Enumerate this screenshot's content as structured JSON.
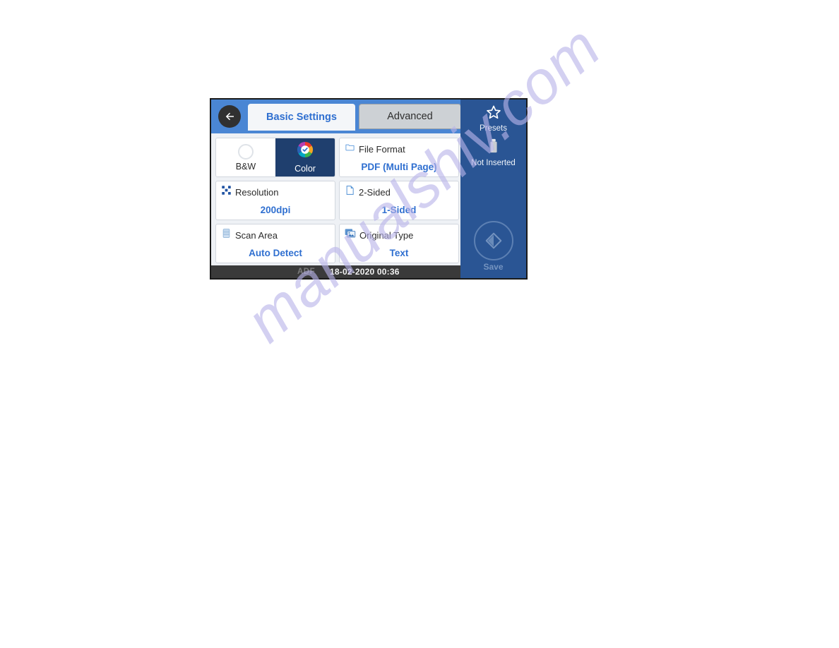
{
  "panel": {
    "header": {
      "back_icon": "back-arrow-icon",
      "tabs": [
        {
          "label": "Basic Settings",
          "active": true
        },
        {
          "label": "Advanced",
          "active": false
        }
      ]
    },
    "color_mode": {
      "bw": {
        "label": "B&W",
        "icon": "empty-circle-icon",
        "selected": false
      },
      "color": {
        "label": "Color",
        "icon": "color-wheel-check-icon",
        "selected": true
      }
    },
    "settings": [
      {
        "label": "File Format",
        "value": "PDF (Multi Page)",
        "icon": "folder-icon"
      },
      {
        "label": "Resolution",
        "value": "200dpi",
        "icon": "dot-matrix-icon"
      },
      {
        "label": "2-Sided",
        "value": "1-Sided",
        "icon": "page-corner-icon"
      },
      {
        "label": "Scan Area",
        "value": "Auto Detect",
        "icon": "document-stack-icon"
      },
      {
        "label": "Original Type",
        "value": "Text",
        "icon": "photo-stack-icon"
      }
    ],
    "status_bar": {
      "source": "ADF",
      "datetime": "18-02-2020 00:36"
    },
    "side_panel": {
      "presets": {
        "label": "Presets",
        "icon": "star-icon"
      },
      "usb": {
        "label": "Not Inserted",
        "icon": "usb-drive-icon"
      },
      "save": {
        "label": "Save",
        "icon": "diamond-start-icon",
        "enabled": false
      }
    },
    "colors": {
      "header_blue": "#4a86d4",
      "side_panel_blue": "#2a5594",
      "selected_navy": "#1f3f6e",
      "value_blue": "#2f6fd0",
      "status_bar_dark": "#3a3a3a",
      "screen_background": "#eef1f5"
    }
  },
  "watermark": {
    "text": "manualshiv.com",
    "color": "#b9b4ea"
  }
}
